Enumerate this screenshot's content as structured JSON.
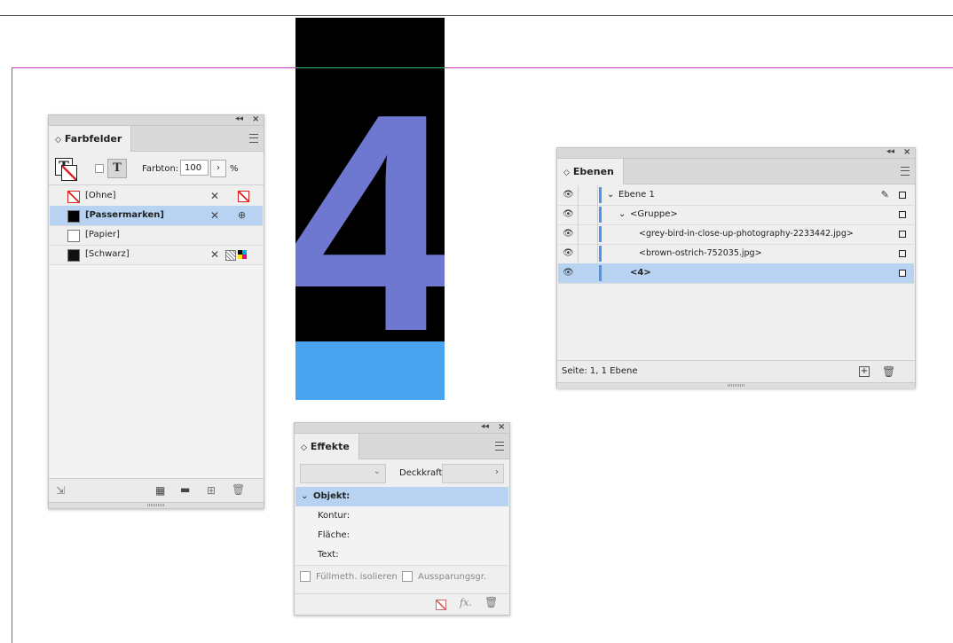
{
  "artwork": {
    "glyph": "4"
  },
  "farbfelder": {
    "tab_label": "Farbfelder",
    "tint_label": "Farbton:",
    "tint_value": "100",
    "tint_unit": "%",
    "swatches": [
      {
        "name": "[Ohne]",
        "color": "none"
      },
      {
        "name": "[Passermarken]",
        "color": "#000000",
        "selected": true
      },
      {
        "name": "[Papier]",
        "color": "#ffffff"
      },
      {
        "name": "[Schwarz]",
        "color": "#000000"
      }
    ]
  },
  "ebenen": {
    "tab_label": "Ebenen",
    "layers": [
      {
        "name": "Ebene 1",
        "indent": 0,
        "expanded": true
      },
      {
        "name": "<Gruppe>",
        "indent": 1,
        "expanded": true
      },
      {
        "name": "<grey-bird-in-close-up-photography-2233442.jpg>",
        "indent": 2
      },
      {
        "name": "<brown-ostrich-752035.jpg>",
        "indent": 2
      },
      {
        "name": "<4>",
        "indent": 2,
        "selected": true
      }
    ],
    "status": "Seite: 1, 1 Ebene"
  },
  "effekte": {
    "tab_label": "Effekte",
    "opacity_label": "Deckkraft:",
    "rows": [
      "Objekt:",
      "Kontur:",
      "Fläche:",
      "Text:"
    ],
    "isolate_label": "Füllmeth. isolieren",
    "knockout_label": "Aussparungsgr.",
    "fx_label": "fx."
  },
  "colors": {
    "accent": "#4f93e8",
    "selection": "#b7d3f1",
    "guide": "#c23cc2"
  }
}
